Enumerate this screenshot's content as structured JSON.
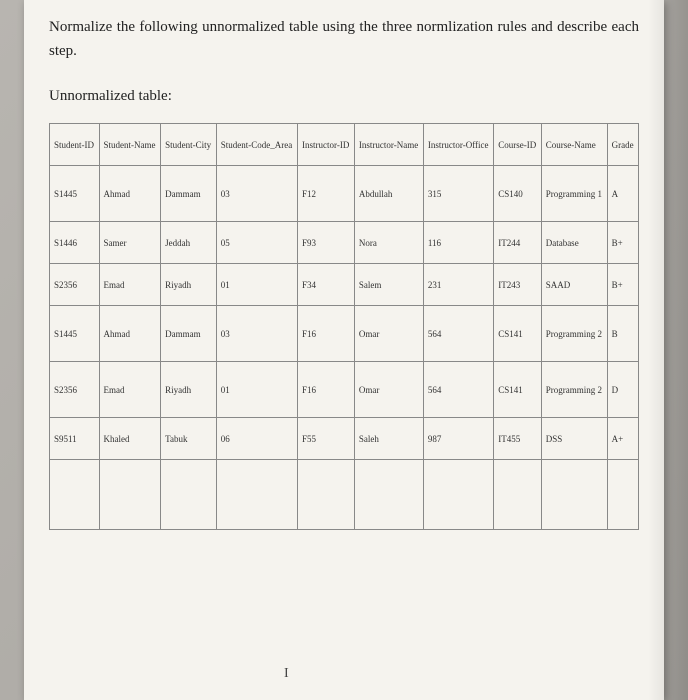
{
  "instruction": "Normalize the following unnormalized table using the three normlization rules and describe each step.",
  "subtitle": "Unnormalized table:",
  "headers": {
    "c0": "Student-ID",
    "c1": "Student-Name",
    "c2": "Student-City",
    "c3": "Student-Code_Area",
    "c4": "Instructor-ID",
    "c5": "Instructor-Name",
    "c6": "Instructor-Office",
    "c7": "Course-ID",
    "c8": "Course-Name",
    "c9": "Grade"
  },
  "rows": [
    {
      "c0": "S1445",
      "c1": "Ahmad",
      "c2": "Dammam",
      "c3": "03",
      "c4": "F12",
      "c5": "Abdullah",
      "c6": "315",
      "c7": "CS140",
      "c8": "Programming 1",
      "c9": "A"
    },
    {
      "c0": "S1446",
      "c1": "Samer",
      "c2": "Jeddah",
      "c3": "05",
      "c4": "F93",
      "c5": "Nora",
      "c6": "116",
      "c7": "IT244",
      "c8": "Database",
      "c9": "B+"
    },
    {
      "c0": "S2356",
      "c1": "Emad",
      "c2": "Riyadh",
      "c3": "01",
      "c4": "F34",
      "c5": "Salem",
      "c6": "231",
      "c7": "IT243",
      "c8": "SAAD",
      "c9": "B+"
    },
    {
      "c0": "S1445",
      "c1": "Ahmad",
      "c2": "Dammam",
      "c3": "03",
      "c4": "F16",
      "c5": "Omar",
      "c6": "564",
      "c7": "CS141",
      "c8": "Programming 2",
      "c9": "B"
    },
    {
      "c0": "S2356",
      "c1": "Emad",
      "c2": "Riyadh",
      "c3": "01",
      "c4": "F16",
      "c5": "Omar",
      "c6": "564",
      "c7": "CS141",
      "c8": "Programming 2",
      "c9": "D"
    },
    {
      "c0": "S9511",
      "c1": "Khaled",
      "c2": "Tabuk",
      "c3": "06",
      "c4": "F55",
      "c5": "Saleh",
      "c6": "987",
      "c7": "IT455",
      "c8": "DSS",
      "c9": "A+"
    }
  ],
  "cursor": "I",
  "chart_data": {
    "type": "table",
    "title": "Unnormalized table",
    "columns": [
      "Student-ID",
      "Student-Name",
      "Student-City",
      "Student-Code_Area",
      "Instructor-ID",
      "Instructor-Name",
      "Instructor-Office",
      "Course-ID",
      "Course-Name",
      "Grade"
    ],
    "rows": [
      [
        "S1445",
        "Ahmad",
        "Dammam",
        "03",
        "F12",
        "Abdullah",
        "315",
        "CS140",
        "Programming 1",
        "A"
      ],
      [
        "S1446",
        "Samer",
        "Jeddah",
        "05",
        "F93",
        "Nora",
        "116",
        "IT244",
        "Database",
        "B+"
      ],
      [
        "S2356",
        "Emad",
        "Riyadh",
        "01",
        "F34",
        "Salem",
        "231",
        "IT243",
        "SAAD",
        "B+"
      ],
      [
        "S1445",
        "Ahmad",
        "Dammam",
        "03",
        "F16",
        "Omar",
        "564",
        "CS141",
        "Programming 2",
        "B"
      ],
      [
        "S2356",
        "Emad",
        "Riyadh",
        "01",
        "F16",
        "Omar",
        "564",
        "CS141",
        "Programming 2",
        "D"
      ],
      [
        "S9511",
        "Khaled",
        "Tabuk",
        "06",
        "F55",
        "Saleh",
        "987",
        "IT455",
        "DSS",
        "A+"
      ]
    ]
  }
}
